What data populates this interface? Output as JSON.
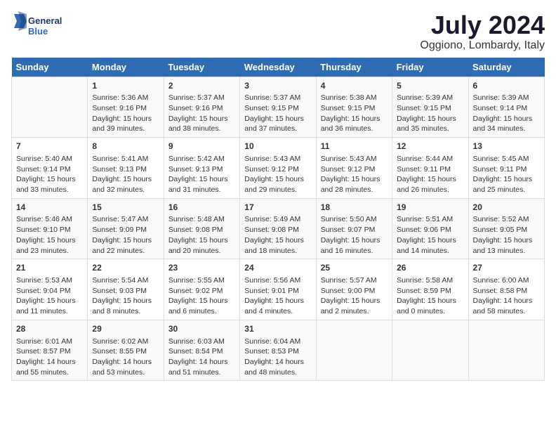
{
  "header": {
    "logo_line1": "General",
    "logo_line2": "Blue",
    "title": "July 2024",
    "subtitle": "Oggiono, Lombardy, Italy"
  },
  "calendar": {
    "weekdays": [
      "Sunday",
      "Monday",
      "Tuesday",
      "Wednesday",
      "Thursday",
      "Friday",
      "Saturday"
    ],
    "weeks": [
      [
        {
          "day": "",
          "info": ""
        },
        {
          "day": "1",
          "info": "Sunrise: 5:36 AM\nSunset: 9:16 PM\nDaylight: 15 hours\nand 39 minutes."
        },
        {
          "day": "2",
          "info": "Sunrise: 5:37 AM\nSunset: 9:16 PM\nDaylight: 15 hours\nand 38 minutes."
        },
        {
          "day": "3",
          "info": "Sunrise: 5:37 AM\nSunset: 9:15 PM\nDaylight: 15 hours\nand 37 minutes."
        },
        {
          "day": "4",
          "info": "Sunrise: 5:38 AM\nSunset: 9:15 PM\nDaylight: 15 hours\nand 36 minutes."
        },
        {
          "day": "5",
          "info": "Sunrise: 5:39 AM\nSunset: 9:15 PM\nDaylight: 15 hours\nand 35 minutes."
        },
        {
          "day": "6",
          "info": "Sunrise: 5:39 AM\nSunset: 9:14 PM\nDaylight: 15 hours\nand 34 minutes."
        }
      ],
      [
        {
          "day": "7",
          "info": "Sunrise: 5:40 AM\nSunset: 9:14 PM\nDaylight: 15 hours\nand 33 minutes."
        },
        {
          "day": "8",
          "info": "Sunrise: 5:41 AM\nSunset: 9:13 PM\nDaylight: 15 hours\nand 32 minutes."
        },
        {
          "day": "9",
          "info": "Sunrise: 5:42 AM\nSunset: 9:13 PM\nDaylight: 15 hours\nand 31 minutes."
        },
        {
          "day": "10",
          "info": "Sunrise: 5:43 AM\nSunset: 9:12 PM\nDaylight: 15 hours\nand 29 minutes."
        },
        {
          "day": "11",
          "info": "Sunrise: 5:43 AM\nSunset: 9:12 PM\nDaylight: 15 hours\nand 28 minutes."
        },
        {
          "day": "12",
          "info": "Sunrise: 5:44 AM\nSunset: 9:11 PM\nDaylight: 15 hours\nand 26 minutes."
        },
        {
          "day": "13",
          "info": "Sunrise: 5:45 AM\nSunset: 9:11 PM\nDaylight: 15 hours\nand 25 minutes."
        }
      ],
      [
        {
          "day": "14",
          "info": "Sunrise: 5:46 AM\nSunset: 9:10 PM\nDaylight: 15 hours\nand 23 minutes."
        },
        {
          "day": "15",
          "info": "Sunrise: 5:47 AM\nSunset: 9:09 PM\nDaylight: 15 hours\nand 22 minutes."
        },
        {
          "day": "16",
          "info": "Sunrise: 5:48 AM\nSunset: 9:08 PM\nDaylight: 15 hours\nand 20 minutes."
        },
        {
          "day": "17",
          "info": "Sunrise: 5:49 AM\nSunset: 9:08 PM\nDaylight: 15 hours\nand 18 minutes."
        },
        {
          "day": "18",
          "info": "Sunrise: 5:50 AM\nSunset: 9:07 PM\nDaylight: 15 hours\nand 16 minutes."
        },
        {
          "day": "19",
          "info": "Sunrise: 5:51 AM\nSunset: 9:06 PM\nDaylight: 15 hours\nand 14 minutes."
        },
        {
          "day": "20",
          "info": "Sunrise: 5:52 AM\nSunset: 9:05 PM\nDaylight: 15 hours\nand 13 minutes."
        }
      ],
      [
        {
          "day": "21",
          "info": "Sunrise: 5:53 AM\nSunset: 9:04 PM\nDaylight: 15 hours\nand 11 minutes."
        },
        {
          "day": "22",
          "info": "Sunrise: 5:54 AM\nSunset: 9:03 PM\nDaylight: 15 hours\nand 8 minutes."
        },
        {
          "day": "23",
          "info": "Sunrise: 5:55 AM\nSunset: 9:02 PM\nDaylight: 15 hours\nand 6 minutes."
        },
        {
          "day": "24",
          "info": "Sunrise: 5:56 AM\nSunset: 9:01 PM\nDaylight: 15 hours\nand 4 minutes."
        },
        {
          "day": "25",
          "info": "Sunrise: 5:57 AM\nSunset: 9:00 PM\nDaylight: 15 hours\nand 2 minutes."
        },
        {
          "day": "26",
          "info": "Sunrise: 5:58 AM\nSunset: 8:59 PM\nDaylight: 15 hours\nand 0 minutes."
        },
        {
          "day": "27",
          "info": "Sunrise: 6:00 AM\nSunset: 8:58 PM\nDaylight: 14 hours\nand 58 minutes."
        }
      ],
      [
        {
          "day": "28",
          "info": "Sunrise: 6:01 AM\nSunset: 8:57 PM\nDaylight: 14 hours\nand 55 minutes."
        },
        {
          "day": "29",
          "info": "Sunrise: 6:02 AM\nSunset: 8:55 PM\nDaylight: 14 hours\nand 53 minutes."
        },
        {
          "day": "30",
          "info": "Sunrise: 6:03 AM\nSunset: 8:54 PM\nDaylight: 14 hours\nand 51 minutes."
        },
        {
          "day": "31",
          "info": "Sunrise: 6:04 AM\nSunset: 8:53 PM\nDaylight: 14 hours\nand 48 minutes."
        },
        {
          "day": "",
          "info": ""
        },
        {
          "day": "",
          "info": ""
        },
        {
          "day": "",
          "info": ""
        }
      ]
    ]
  }
}
